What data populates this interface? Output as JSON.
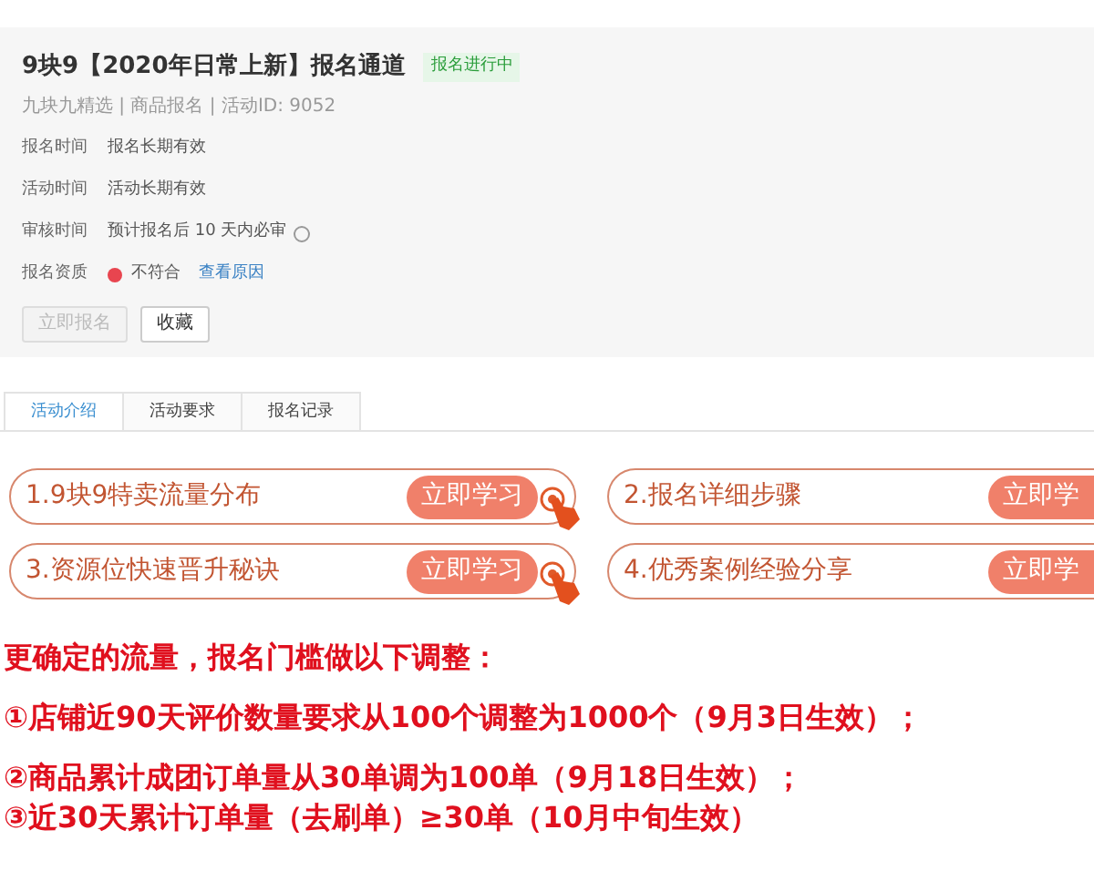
{
  "panel": {
    "title": "9块9【2020年日常上新】报名通道",
    "status_badge": "报名进行中",
    "subtitle": "九块九精选 | 商品报名 | 活动ID: 9052",
    "fields": [
      {
        "kind": "text",
        "label": "报名时间",
        "value": "报名长期有效"
      },
      {
        "kind": "text",
        "label": "活动时间",
        "value": "活动长期有效"
      },
      {
        "kind": "help",
        "label": "审核时间",
        "value": "预计报名后 10 天内必审"
      },
      {
        "kind": "status",
        "label": "报名资质",
        "value": "不符合",
        "link": "查看原因"
      }
    ],
    "buttons": [
      {
        "label": "立即报名",
        "disabled": true
      },
      {
        "label": "收藏",
        "disabled": false
      }
    ]
  },
  "tabs": [
    {
      "label": "活动介绍",
      "selected": true
    },
    {
      "label": "活动要求",
      "selected": false
    },
    {
      "label": "报名记录",
      "selected": false
    }
  ],
  "courses": [
    {
      "title": "1.9块9特卖流量分布",
      "button": "立即学习"
    },
    {
      "title": "2.报名详细步骤",
      "button": "立即学"
    },
    {
      "title": "3.资源位快速晋升秘诀",
      "button": "立即学习"
    },
    {
      "title": "4.优秀案例经验分享",
      "button": "立即学"
    }
  ],
  "notice": {
    "heading": "更确定的流量，报名门槛做以下调整：",
    "items": [
      "①店铺近90天评价数量要求从100个调整为1000个（9月3日生效）；",
      "②商品累计成团订单量从30单调为100单（9月18日生效）；",
      "③近30天累计订单量（去刷单）≥30单（10月中旬生效）"
    ]
  }
}
